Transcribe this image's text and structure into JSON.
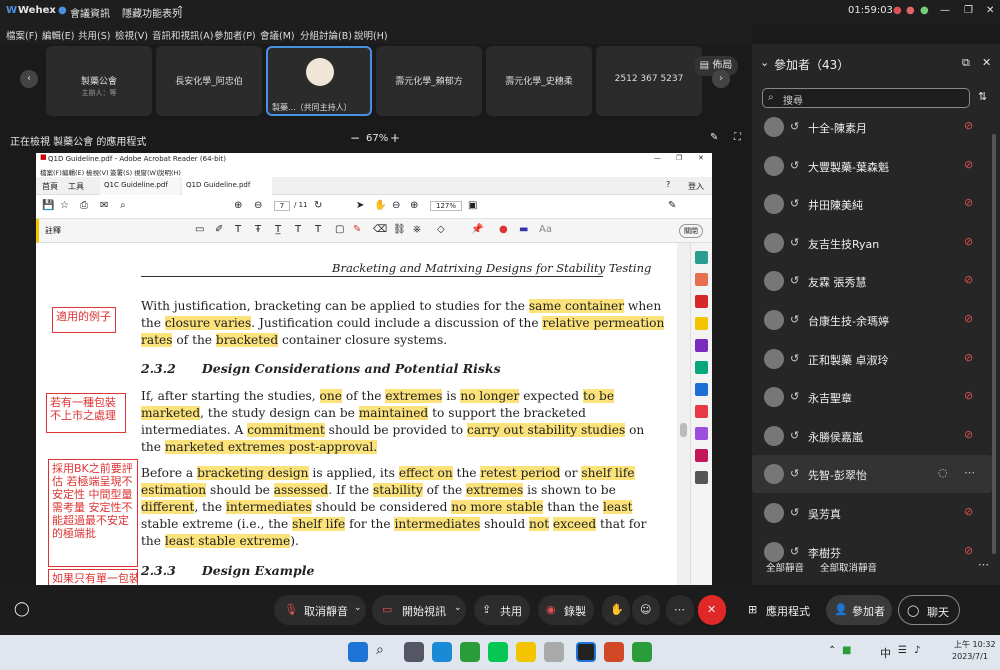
{
  "window": {
    "app_name": "Wehex",
    "status_label": "會議資訊",
    "hidden_features_label": "隱藏功能表列",
    "time": "01:59:03"
  },
  "menu": [
    "檔案(F)",
    "編輯(E)",
    "共用(S)",
    "檢視(V)",
    "音訊和視訊(A)",
    "參加者(P)",
    "會議(M)",
    "分組討論(B)",
    "說明(H)"
  ],
  "video_tiles": [
    {
      "name": "製藥公會",
      "sub": "主辦人：等"
    },
    {
      "name": "長安化學_阿忠伯",
      "sub": ""
    },
    {
      "name": "製藥...（共同主持人）",
      "sub": ""
    },
    {
      "name": "壽元化學_賴郁方",
      "sub": ""
    },
    {
      "name": "壽元化學_史穗柔",
      "sub": ""
    },
    {
      "name": "2512 367 5237",
      "sub": ""
    }
  ],
  "layout_label": "佈局",
  "share_bar": {
    "text": "正在檢視 製藥公會 的應用程式",
    "zoom": "67%",
    "minus": "−",
    "plus": "+"
  },
  "acrobat": {
    "title": "Q1D Guideline.pdf - Adobe Acrobat Reader (64-bit)",
    "menu": [
      "檔案(F)",
      "編輯(E)",
      "檢視(V)",
      "簽署(S)",
      "視窗(W)",
      "說明(H)"
    ],
    "tabs": [
      "首頁",
      "工具",
      "Q1C Guideline.pdf",
      "Q1D Guideline.pdf"
    ],
    "sign_in": "登入",
    "page": "7",
    "pages": "/ 11",
    "zoom": "127%",
    "comment_label": "註釋",
    "close_label": "關閉",
    "doc": {
      "header": "Bracketing and Matrixing Designs for Stability Testing",
      "lines": [
        {
          "parts": [
            [
              "With justification, bracketing can be applied to studies for the ",
              0
            ],
            [
              "same container",
              1
            ],
            [
              " when",
              0
            ]
          ]
        },
        {
          "parts": [
            [
              "the ",
              0
            ],
            [
              "closure varies",
              1
            ],
            [
              ". Justification could include a discussion of the ",
              0
            ],
            [
              "relative permeation",
              1
            ]
          ]
        },
        {
          "parts": [
            [
              "rates",
              1
            ],
            [
              " of the ",
              0
            ],
            [
              "bracketed",
              1
            ],
            [
              " container closure systems.",
              0
            ]
          ]
        },
        {
          "parts": [
            [
              "2.3.2      Design Considerations and Potential Risks",
              2
            ]
          ]
        },
        {
          "parts": [
            [
              "If, after starting the studies, ",
              0
            ],
            [
              "one",
              1
            ],
            [
              " of the ",
              0
            ],
            [
              "extremes",
              1
            ],
            [
              " is ",
              0
            ],
            [
              "no longer",
              1
            ],
            [
              " expected ",
              0
            ],
            [
              "to be",
              1
            ]
          ]
        },
        {
          "parts": [
            [
              "marketed",
              1
            ],
            [
              ", the study design can be ",
              0
            ],
            [
              "maintained",
              1
            ],
            [
              " to support the bracketed",
              0
            ]
          ]
        },
        {
          "parts": [
            [
              "intermediates. A ",
              0
            ],
            [
              "commitment",
              1
            ],
            [
              " should be provided to ",
              0
            ],
            [
              "carry out stability studies",
              1
            ],
            [
              " on",
              0
            ]
          ]
        },
        {
          "parts": [
            [
              "the ",
              0
            ],
            [
              "marketed extremes post-approval.",
              1
            ]
          ]
        },
        {
          "parts": [
            [
              "Before a ",
              0
            ],
            [
              "bracketing design",
              1
            ],
            [
              " is applied, its ",
              0
            ],
            [
              "effect on",
              1
            ],
            [
              " the ",
              0
            ],
            [
              "retest period",
              1
            ],
            [
              " or ",
              0
            ],
            [
              "shelf life",
              1
            ]
          ]
        },
        {
          "parts": [
            [
              "estimation",
              1
            ],
            [
              " should be ",
              0
            ],
            [
              "assessed",
              1
            ],
            [
              ". If the ",
              0
            ],
            [
              "stability",
              1
            ],
            [
              " of the ",
              0
            ],
            [
              "extremes",
              1
            ],
            [
              " is shown to be",
              0
            ]
          ]
        },
        {
          "parts": [
            [
              "different",
              1
            ],
            [
              ", the ",
              0
            ],
            [
              "intermediates",
              1
            ],
            [
              " should be considered ",
              0
            ],
            [
              "no more stable",
              1
            ],
            [
              " than the ",
              0
            ],
            [
              "least",
              1
            ]
          ]
        },
        {
          "parts": [
            [
              "stable extreme (i.e., the ",
              0
            ],
            [
              "shelf life",
              1
            ],
            [
              " for the ",
              0
            ],
            [
              "intermediates",
              1
            ],
            [
              " should ",
              0
            ],
            [
              "not",
              1
            ],
            [
              " ",
              0
            ],
            [
              "exceed",
              1
            ],
            [
              " that for",
              0
            ]
          ]
        },
        {
          "parts": [
            [
              "the ",
              0
            ],
            [
              "least stable extreme",
              1
            ],
            [
              ").",
              0
            ]
          ]
        },
        {
          "parts": [
            [
              "2.3.3      Design Example",
              2
            ]
          ]
        }
      ],
      "notes": [
        "適用的例子",
        "若有一種包裝不上市之處理",
        "採用BK之前要評估 若極端呈現不安定性 中間型量需考量 安定性不能超過最不安定的極端批",
        "如果只有單一包裝"
      ]
    }
  },
  "panel": {
    "title": "參加者（43）",
    "search_placeholder": "搜尋",
    "participants": [
      "十全-陳素月",
      "大豐製藥-葉森魁",
      "井田陳美純",
      "友吉生技Ryan",
      "友霖 張秀慧",
      "台康生技-余瑪婷",
      "正和製藥 卓淑玲",
      "永吉聖章",
      "永勝侯嘉嵐",
      "先智-彭翠怡",
      "吳芳真",
      "李樹芬"
    ],
    "mute_all": "全部靜音",
    "unmute_all": "全部取消靜音"
  },
  "controls": {
    "unmute": "取消靜音",
    "start_video": "開始視訊",
    "share": "共用",
    "record": "錄製",
    "apps": "應用程式",
    "participants": "參加者",
    "chat": "聊天"
  },
  "taskbar": {
    "ime": "中",
    "time": "上午 10:32",
    "date": "2023/7/1"
  },
  "colors": {
    "highlight": "#fbe27a",
    "end_meeting": "#e02828",
    "accent": "#4a90e2"
  }
}
